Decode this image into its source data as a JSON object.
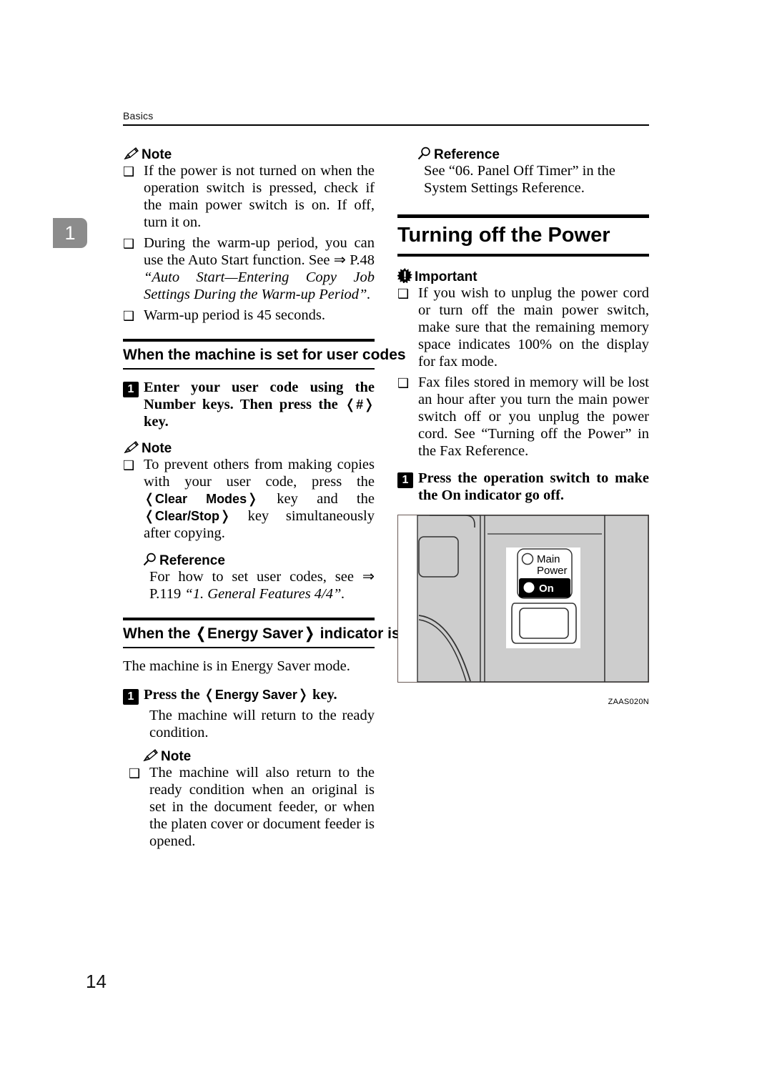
{
  "page": {
    "running_header": "Basics",
    "chapter_tab": "1",
    "folio": "14"
  },
  "left_column": {
    "note_1": {
      "icon": "pencil-icon",
      "label": "Note",
      "items": [
        "If the power is not turned on when the operation switch is pressed, check if the main power switch is on. If off, turn it on.",
        "During the warm-up period, you can use the Auto Start function. See ⇒ P.48 “Auto Start—Entering Copy Job Settings During the Warm-up Period”.",
        "Warm-up period is 45 seconds."
      ],
      "item_2_plain": "During the warm-up period, you can use the Auto Start function. See ⇒ P.48 ",
      "item_2_italic": "“Auto Start—Entering Copy Job Settings During the Warm-up Period”."
    },
    "section_user_codes": {
      "title": "When the machine is set for user codes",
      "step_1": {
        "number": "1",
        "text_part_1": "Enter your user code using the Number keys. Then press the ",
        "key_label": "#",
        "text_part_2": " key."
      },
      "note": {
        "icon": "pencil-icon",
        "label": "Note",
        "item_part_1": "To prevent others from making copies with your user code, press the ",
        "key_1": "Clear Modes",
        "item_part_2": " key and the ",
        "key_2": "Clear/Stop",
        "item_part_3": " key simultaneously after copying."
      },
      "reference": {
        "icon": "magnifier-icon",
        "label": "Reference",
        "text_plain": "For how to set user codes, see ⇒ P.119 ",
        "text_italic": "“1. General Features 4/4”."
      }
    },
    "section_energy_saver": {
      "title_part_1": "When the ",
      "title_key": "Energy Saver",
      "title_part_2": " indicator is lit",
      "intro": "The machine is in Energy Saver mode.",
      "step_1": {
        "number": "1",
        "text_part_1": "Press the ",
        "key_label": "Energy Saver",
        "text_part_2": " key."
      },
      "step_1_body": "The machine will return to the ready condition.",
      "note": {
        "icon": "pencil-icon",
        "label": "Note",
        "item": "The machine will also return to the ready condition when an original is set in the document feeder, or when the platen cover or document feeder is opened."
      }
    }
  },
  "right_column": {
    "reference_top": {
      "icon": "magnifier-icon",
      "label": "Reference",
      "text": "See “06. Panel Off Timer” in the System Settings Reference."
    },
    "main_heading": "Turning off the Power",
    "important": {
      "icon": "important-starburst-icon",
      "label": "Important",
      "items": [
        "If you wish to unplug the power cord or turn off the main power switch, make sure that the remaining memory space indicates 100% on the display for fax mode.",
        "Fax files stored in memory will be lost an hour after you turn the main power switch off or you unplug the power cord. See “Turning off the Power” in the Fax Reference."
      ]
    },
    "step_1": {
      "number": "1",
      "text": "Press the operation switch to make the On indicator go off."
    },
    "figure": {
      "name": "main-power-switch-illustration",
      "label_line_1": "Main",
      "label_line_2": "Power",
      "label_on": "On",
      "caption": "ZAAS020N"
    }
  },
  "colors": {
    "machine_body": "#cdcdcd",
    "panel_white": "#ffffff",
    "on_badge": "#000000",
    "chapter_tab": "#8c8c8c",
    "rule": "#000000"
  }
}
